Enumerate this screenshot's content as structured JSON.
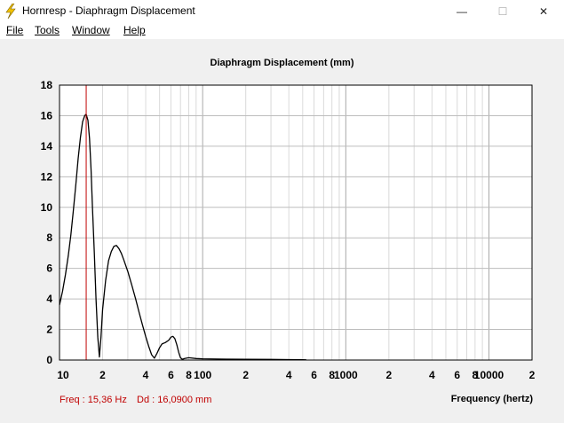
{
  "window": {
    "title": "Hornresp - Diaphragm Displacement",
    "controls": {
      "minimize": "—",
      "maximize": "☐",
      "close": "✕"
    }
  },
  "menu": [
    "File",
    "Tools",
    "Window",
    "Help"
  ],
  "chart": {
    "title": "Diaphragm Displacement (mm)",
    "xlabel": "Frequency (hertz)"
  },
  "readout": {
    "freq": "Freq : 15,36 Hz",
    "dd": "Dd : 16,0900 mm"
  },
  "colors": {
    "curve": "#000000",
    "cursor": "#c00000",
    "grid": "#c8c8c8",
    "plot_bg": "#ffffff"
  },
  "chart_data": {
    "type": "line",
    "title": "Diaphragm Displacement (mm)",
    "xlabel": "Frequency (hertz)",
    "ylabel": "",
    "xscale": "log",
    "xlim": [
      10,
      20000
    ],
    "ylim": [
      0,
      18
    ],
    "yticks": [
      0,
      2,
      4,
      6,
      8,
      10,
      12,
      14,
      16,
      18
    ],
    "xtick_labels": [
      {
        "x": 10,
        "label": "10"
      },
      {
        "x": 20,
        "label": "2"
      },
      {
        "x": 40,
        "label": "4"
      },
      {
        "x": 60,
        "label": "6"
      },
      {
        "x": 80,
        "label": "8"
      },
      {
        "x": 100,
        "label": "100"
      },
      {
        "x": 200,
        "label": "2"
      },
      {
        "x": 400,
        "label": "4"
      },
      {
        "x": 600,
        "label": "6"
      },
      {
        "x": 800,
        "label": "8"
      },
      {
        "x": 1000,
        "label": "1000"
      },
      {
        "x": 2000,
        "label": "2"
      },
      {
        "x": 4000,
        "label": "4"
      },
      {
        "x": 6000,
        "label": "6"
      },
      {
        "x": 8000,
        "label": "8"
      },
      {
        "x": 10000,
        "label": "10000"
      },
      {
        "x": 20000,
        "label": "2"
      }
    ],
    "cursor_x": 15.36,
    "grid": true,
    "series": [
      {
        "points": [
          [
            10,
            3.6
          ],
          [
            10.5,
            4.5
          ],
          [
            11,
            5.6
          ],
          [
            11.5,
            6.8
          ],
          [
            12,
            8.2
          ],
          [
            12.5,
            9.8
          ],
          [
            13,
            11.5
          ],
          [
            13.5,
            13.2
          ],
          [
            14,
            14.6
          ],
          [
            14.5,
            15.6
          ],
          [
            15,
            16.0
          ],
          [
            15.36,
            16.09
          ],
          [
            15.8,
            15.7
          ],
          [
            16.2,
            14.5
          ],
          [
            16.6,
            12.5
          ],
          [
            17,
            10.0
          ],
          [
            17.5,
            7.0
          ],
          [
            18,
            4.0
          ],
          [
            18.5,
            1.5
          ],
          [
            19,
            0.2
          ],
          [
            19.5,
            1.5
          ],
          [
            20,
            3.3
          ],
          [
            21,
            5.2
          ],
          [
            22,
            6.5
          ],
          [
            23,
            7.1
          ],
          [
            24,
            7.45
          ],
          [
            25,
            7.5
          ],
          [
            26,
            7.3
          ],
          [
            27,
            7.0
          ],
          [
            28,
            6.6
          ],
          [
            30,
            5.8
          ],
          [
            32,
            4.9
          ],
          [
            34,
            4.0
          ],
          [
            36,
            3.1
          ],
          [
            38,
            2.3
          ],
          [
            40,
            1.55
          ],
          [
            42,
            0.9
          ],
          [
            44,
            0.35
          ],
          [
            46,
            0.12
          ],
          [
            48,
            0.45
          ],
          [
            50,
            0.8
          ],
          [
            52,
            1.05
          ],
          [
            55,
            1.15
          ],
          [
            58,
            1.3
          ],
          [
            60,
            1.5
          ],
          [
            62,
            1.55
          ],
          [
            64,
            1.4
          ],
          [
            66,
            1.0
          ],
          [
            68,
            0.5
          ],
          [
            70,
            0.15
          ],
          [
            72,
            0.05
          ],
          [
            75,
            0.1
          ],
          [
            80,
            0.15
          ],
          [
            90,
            0.1
          ],
          [
            100,
            0.08
          ],
          [
            150,
            0.06
          ],
          [
            200,
            0.05
          ],
          [
            300,
            0.04
          ],
          [
            400,
            0.03
          ],
          [
            500,
            0.02
          ],
          [
            530,
            0.01
          ]
        ]
      }
    ]
  }
}
